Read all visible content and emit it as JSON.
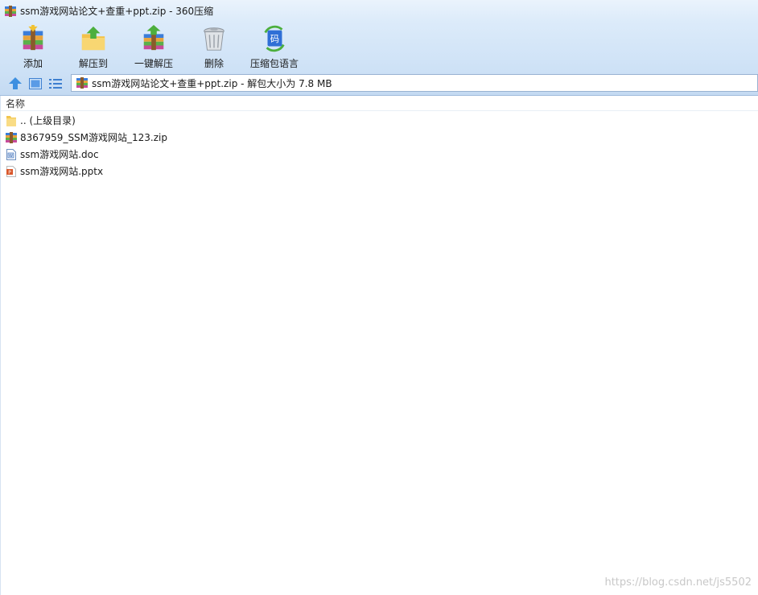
{
  "window": {
    "title": "ssm游戏网站论文+查重+ppt.zip - 360压缩"
  },
  "toolbar": {
    "buttons": [
      {
        "label": "添加",
        "icon": "add-archive-icon"
      },
      {
        "label": "解压到",
        "icon": "extract-to-icon"
      },
      {
        "label": "一键解压",
        "icon": "one-click-extract-icon"
      },
      {
        "label": "删除",
        "icon": "trash-icon"
      },
      {
        "label": "压缩包语言",
        "icon": "encoding-icon"
      }
    ]
  },
  "navbar": {
    "path_text": "ssm游戏网站论文+查重+ppt.zip - 解包大小为 7.8 MB"
  },
  "list": {
    "column_name": "名称",
    "items": [
      {
        "name": ".. (上级目录)",
        "icon": "folder-icon"
      },
      {
        "name": "8367959_SSM游戏网站_123.zip",
        "icon": "zip-icon"
      },
      {
        "name": "ssm游戏网站.doc",
        "icon": "doc-icon"
      },
      {
        "name": "ssm游戏网站.pptx",
        "icon": "pptx-icon"
      }
    ]
  },
  "watermark": "https://blog.csdn.net/js5502"
}
